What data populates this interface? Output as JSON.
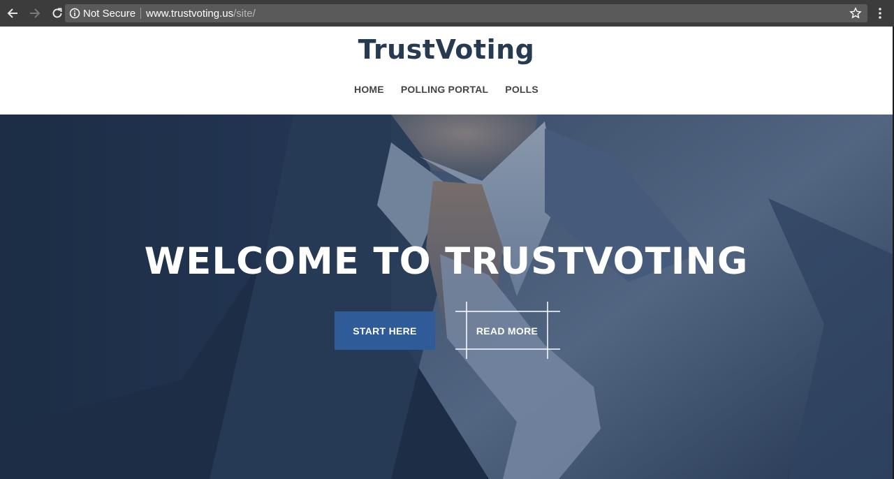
{
  "browser": {
    "security_label": "Not Secure",
    "url_host": "www.trustvoting.us",
    "url_path": "/site/",
    "icons": [
      "back-icon",
      "forward-icon",
      "reload-icon",
      "info-icon",
      "star-icon",
      "menu-icon"
    ]
  },
  "site": {
    "title": "TrustVoting",
    "nav": [
      "HOME",
      "POLLING PORTAL",
      "POLLS"
    ]
  },
  "hero": {
    "heading": "WELCOME TO TRUSTVOTING",
    "primary_button": "START HERE",
    "secondary_button": "READ MORE"
  },
  "colors": {
    "chrome": "#3c3c3c",
    "title": "#263a52",
    "hero_bg": "#1c2d45",
    "primary_button": "#2f5b98"
  }
}
